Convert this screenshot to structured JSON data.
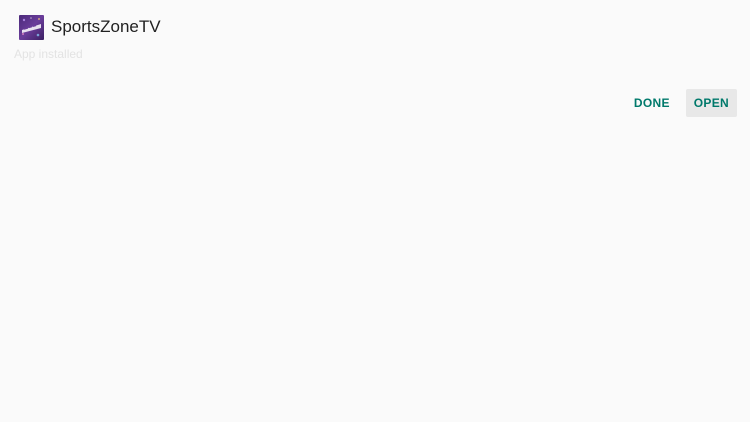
{
  "app": {
    "name": "SportsZoneTV",
    "icon": "sportszonetv-logo-icon",
    "status": "App installed"
  },
  "actions": {
    "done_label": "DONE",
    "open_label": "OPEN"
  },
  "colors": {
    "accent": "#00796b",
    "background": "#fafafa",
    "focused_button": "#e8e8e8",
    "icon_bg": "#4b2a7a"
  }
}
